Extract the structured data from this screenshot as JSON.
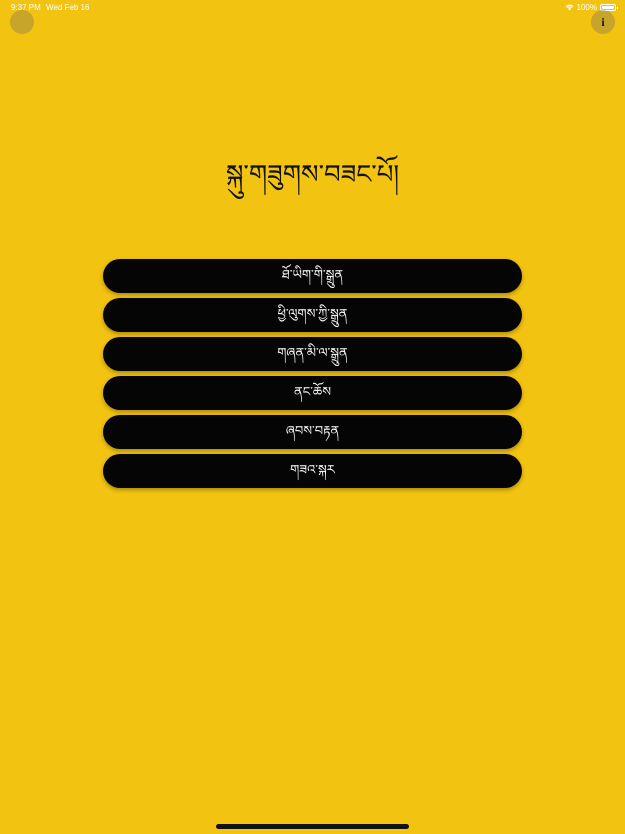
{
  "status_bar": {
    "time": "9:37 PM",
    "date": "Wed Feb 16",
    "battery": "100%"
  },
  "header": {
    "left_icon": "circle-button-icon",
    "info_icon": "info-icon",
    "info_glyph": "i"
  },
  "title": "སྐུ་གཟུགས་བཟང་པོ།",
  "menu": {
    "items": [
      {
        "label": "ཐོ་ཡིག་གི་སྒྲུན"
      },
      {
        "label": "ཕྱི་ལུགས་ཀྱི་སྒྲུན"
      },
      {
        "label": "གཞན་མི་ལ་སྒྲུན"
      },
      {
        "label": "ནང་ཆོས"
      },
      {
        "label": "ཞབས་བརྟན"
      },
      {
        "label": "གཟའ་སྐར"
      }
    ]
  },
  "colors": {
    "background": "#F2C311",
    "button": "#050505",
    "button_text": "#FFFFFF"
  }
}
